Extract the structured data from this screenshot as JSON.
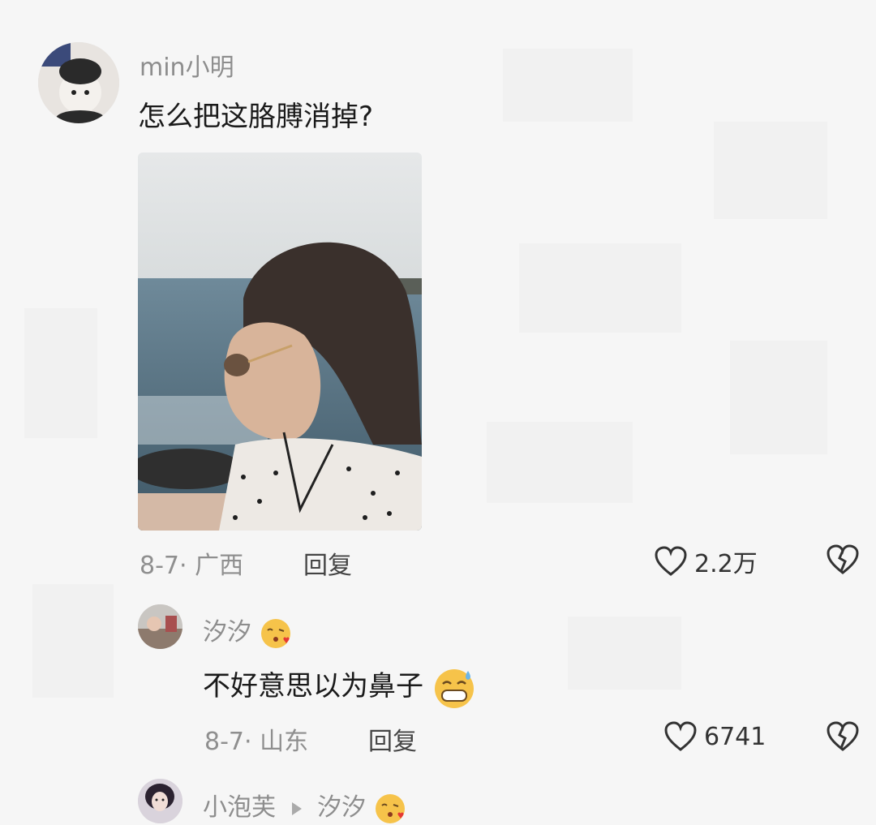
{
  "comment1": {
    "username": "min小明",
    "text": "怎么把这胳膊消掉?",
    "date_location": "8-7· 广西",
    "reply_label": "回复",
    "likes": "2.2万"
  },
  "comment2": {
    "username": "汐汐",
    "text": "不好意思以为鼻子",
    "date_location": "8-7· 山东",
    "reply_label": "回复",
    "likes": "6741"
  },
  "comment3": {
    "username": "小泡芙",
    "reply_to": "汐汐"
  },
  "colors": {
    "background": "#f6f6f6",
    "meta_gray": "#8f8f8f"
  }
}
